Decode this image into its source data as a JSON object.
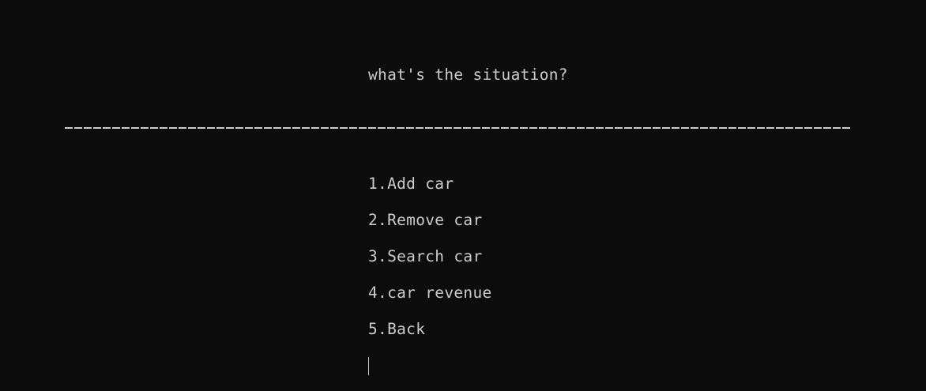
{
  "terminal": {
    "title_prompt": "what's the situation?",
    "separator": "--------------------------------------------------------------------------------------------------",
    "menu_items": [
      {
        "label": "1.Add car"
      },
      {
        "label": "2.Remove car"
      },
      {
        "label": "3.Search car"
      },
      {
        "label": "4.car revenue"
      },
      {
        "label": "5.Back"
      }
    ],
    "colors": {
      "background": "#0c0c0c",
      "foreground": "#cccccc"
    }
  }
}
